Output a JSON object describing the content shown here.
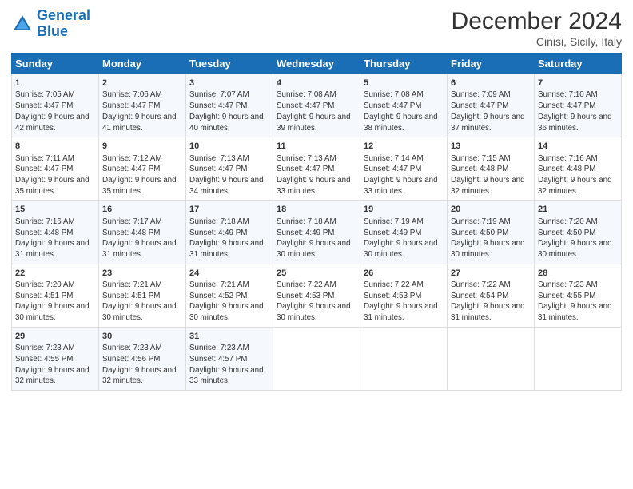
{
  "logo": {
    "line1": "General",
    "line2": "Blue"
  },
  "title": "December 2024",
  "subtitle": "Cinisi, Sicily, Italy",
  "days_of_week": [
    "Sunday",
    "Monday",
    "Tuesday",
    "Wednesday",
    "Thursday",
    "Friday",
    "Saturday"
  ],
  "weeks": [
    [
      {
        "day": "1",
        "sunrise": "Sunrise: 7:05 AM",
        "sunset": "Sunset: 4:47 PM",
        "daylight": "Daylight: 9 hours and 42 minutes."
      },
      {
        "day": "2",
        "sunrise": "Sunrise: 7:06 AM",
        "sunset": "Sunset: 4:47 PM",
        "daylight": "Daylight: 9 hours and 41 minutes."
      },
      {
        "day": "3",
        "sunrise": "Sunrise: 7:07 AM",
        "sunset": "Sunset: 4:47 PM",
        "daylight": "Daylight: 9 hours and 40 minutes."
      },
      {
        "day": "4",
        "sunrise": "Sunrise: 7:08 AM",
        "sunset": "Sunset: 4:47 PM",
        "daylight": "Daylight: 9 hours and 39 minutes."
      },
      {
        "day": "5",
        "sunrise": "Sunrise: 7:08 AM",
        "sunset": "Sunset: 4:47 PM",
        "daylight": "Daylight: 9 hours and 38 minutes."
      },
      {
        "day": "6",
        "sunrise": "Sunrise: 7:09 AM",
        "sunset": "Sunset: 4:47 PM",
        "daylight": "Daylight: 9 hours and 37 minutes."
      },
      {
        "day": "7",
        "sunrise": "Sunrise: 7:10 AM",
        "sunset": "Sunset: 4:47 PM",
        "daylight": "Daylight: 9 hours and 36 minutes."
      }
    ],
    [
      {
        "day": "8",
        "sunrise": "Sunrise: 7:11 AM",
        "sunset": "Sunset: 4:47 PM",
        "daylight": "Daylight: 9 hours and 35 minutes."
      },
      {
        "day": "9",
        "sunrise": "Sunrise: 7:12 AM",
        "sunset": "Sunset: 4:47 PM",
        "daylight": "Daylight: 9 hours and 35 minutes."
      },
      {
        "day": "10",
        "sunrise": "Sunrise: 7:13 AM",
        "sunset": "Sunset: 4:47 PM",
        "daylight": "Daylight: 9 hours and 34 minutes."
      },
      {
        "day": "11",
        "sunrise": "Sunrise: 7:13 AM",
        "sunset": "Sunset: 4:47 PM",
        "daylight": "Daylight: 9 hours and 33 minutes."
      },
      {
        "day": "12",
        "sunrise": "Sunrise: 7:14 AM",
        "sunset": "Sunset: 4:47 PM",
        "daylight": "Daylight: 9 hours and 33 minutes."
      },
      {
        "day": "13",
        "sunrise": "Sunrise: 7:15 AM",
        "sunset": "Sunset: 4:48 PM",
        "daylight": "Daylight: 9 hours and 32 minutes."
      },
      {
        "day": "14",
        "sunrise": "Sunrise: 7:16 AM",
        "sunset": "Sunset: 4:48 PM",
        "daylight": "Daylight: 9 hours and 32 minutes."
      }
    ],
    [
      {
        "day": "15",
        "sunrise": "Sunrise: 7:16 AM",
        "sunset": "Sunset: 4:48 PM",
        "daylight": "Daylight: 9 hours and 31 minutes."
      },
      {
        "day": "16",
        "sunrise": "Sunrise: 7:17 AM",
        "sunset": "Sunset: 4:48 PM",
        "daylight": "Daylight: 9 hours and 31 minutes."
      },
      {
        "day": "17",
        "sunrise": "Sunrise: 7:18 AM",
        "sunset": "Sunset: 4:49 PM",
        "daylight": "Daylight: 9 hours and 31 minutes."
      },
      {
        "day": "18",
        "sunrise": "Sunrise: 7:18 AM",
        "sunset": "Sunset: 4:49 PM",
        "daylight": "Daylight: 9 hours and 30 minutes."
      },
      {
        "day": "19",
        "sunrise": "Sunrise: 7:19 AM",
        "sunset": "Sunset: 4:49 PM",
        "daylight": "Daylight: 9 hours and 30 minutes."
      },
      {
        "day": "20",
        "sunrise": "Sunrise: 7:19 AM",
        "sunset": "Sunset: 4:50 PM",
        "daylight": "Daylight: 9 hours and 30 minutes."
      },
      {
        "day": "21",
        "sunrise": "Sunrise: 7:20 AM",
        "sunset": "Sunset: 4:50 PM",
        "daylight": "Daylight: 9 hours and 30 minutes."
      }
    ],
    [
      {
        "day": "22",
        "sunrise": "Sunrise: 7:20 AM",
        "sunset": "Sunset: 4:51 PM",
        "daylight": "Daylight: 9 hours and 30 minutes."
      },
      {
        "day": "23",
        "sunrise": "Sunrise: 7:21 AM",
        "sunset": "Sunset: 4:51 PM",
        "daylight": "Daylight: 9 hours and 30 minutes."
      },
      {
        "day": "24",
        "sunrise": "Sunrise: 7:21 AM",
        "sunset": "Sunset: 4:52 PM",
        "daylight": "Daylight: 9 hours and 30 minutes."
      },
      {
        "day": "25",
        "sunrise": "Sunrise: 7:22 AM",
        "sunset": "Sunset: 4:53 PM",
        "daylight": "Daylight: 9 hours and 30 minutes."
      },
      {
        "day": "26",
        "sunrise": "Sunrise: 7:22 AM",
        "sunset": "Sunset: 4:53 PM",
        "daylight": "Daylight: 9 hours and 31 minutes."
      },
      {
        "day": "27",
        "sunrise": "Sunrise: 7:22 AM",
        "sunset": "Sunset: 4:54 PM",
        "daylight": "Daylight: 9 hours and 31 minutes."
      },
      {
        "day": "28",
        "sunrise": "Sunrise: 7:23 AM",
        "sunset": "Sunset: 4:55 PM",
        "daylight": "Daylight: 9 hours and 31 minutes."
      }
    ],
    [
      {
        "day": "29",
        "sunrise": "Sunrise: 7:23 AM",
        "sunset": "Sunset: 4:55 PM",
        "daylight": "Daylight: 9 hours and 32 minutes."
      },
      {
        "day": "30",
        "sunrise": "Sunrise: 7:23 AM",
        "sunset": "Sunset: 4:56 PM",
        "daylight": "Daylight: 9 hours and 32 minutes."
      },
      {
        "day": "31",
        "sunrise": "Sunrise: 7:23 AM",
        "sunset": "Sunset: 4:57 PM",
        "daylight": "Daylight: 9 hours and 33 minutes."
      },
      null,
      null,
      null,
      null
    ]
  ]
}
